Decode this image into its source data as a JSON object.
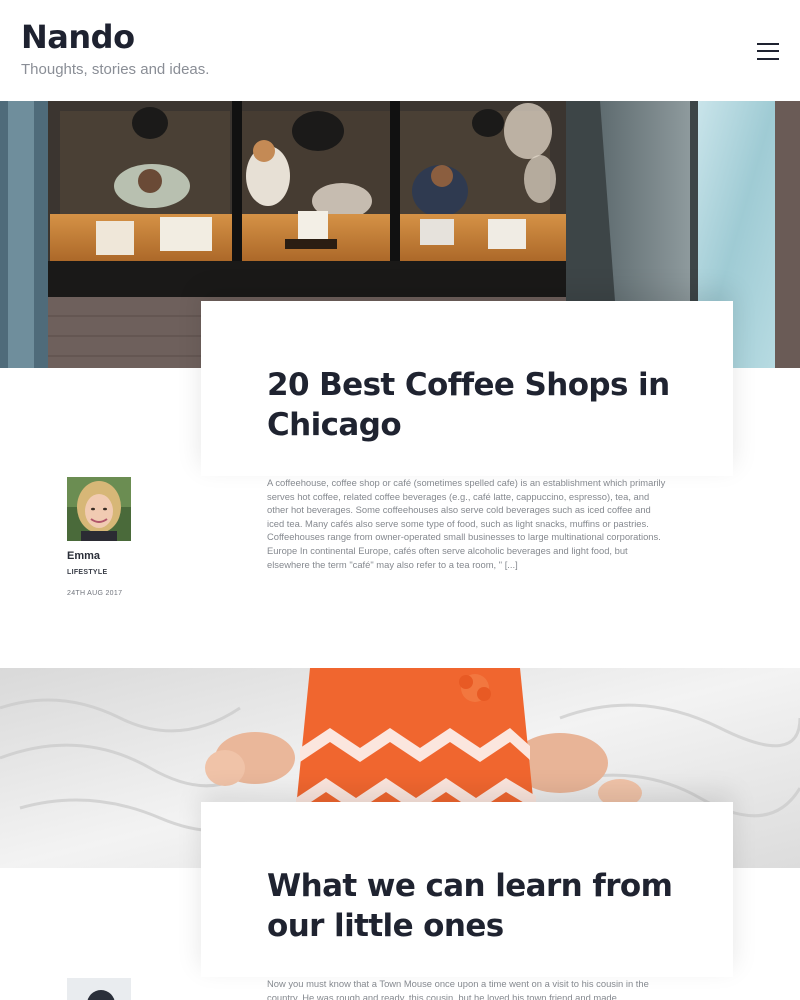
{
  "site": {
    "title": "Nando",
    "tagline": "Thoughts, stories and ideas."
  },
  "icons": {
    "menu": "hamburger-menu-icon"
  },
  "articles": [
    {
      "image": "coffee-shop-overhead-photo",
      "title": "20 Best Coffee Shops in Chicago",
      "author": "Emma",
      "category": "LIFESTYLE",
      "date": "24TH AUG 2017",
      "excerpt": "A coffeehouse, coffee shop or café (sometimes spelled cafe) is an establishment which primarily serves hot coffee, related coffee beverages (e.g., café latte, cappuccino, espresso), tea, and other hot beverages. Some coffeehouses also serve cold beverages such as iced coffee and iced tea. Many cafés also serve some type of food, such as light snacks, muffins or pastries. Coffeehouses range from owner-operated small businesses to large multinational corporations. Europe In continental Europe, cafés often serve alcoholic beverages and light food, but elsewhere the term \"café\" may also refer to a tea room, \" [...]"
    },
    {
      "image": "baby-in-orange-dress-photo",
      "title": "What we can learn from our little ones",
      "excerpt": "Now you must know that a Town Mouse once upon a time went on a visit to his cousin in the country. He was rough and ready, this cousin, but he loved his town friend and made"
    }
  ]
}
